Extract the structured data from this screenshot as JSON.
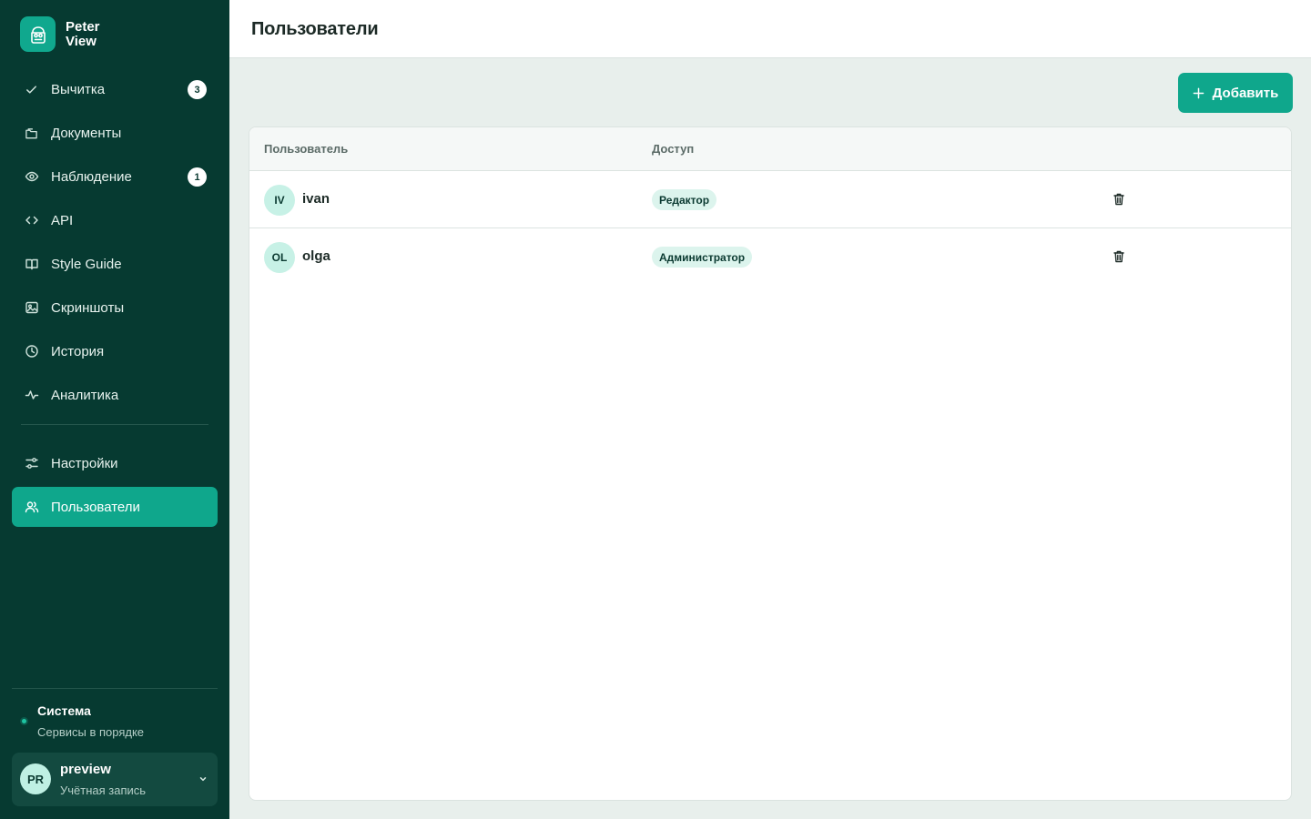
{
  "brand": {
    "name": "Peter View",
    "icon": "peter-logo-icon"
  },
  "sidebar": {
    "nav_primary": [
      {
        "label": "Вычитка",
        "icon": "check-icon",
        "badge": "3"
      },
      {
        "label": "Документы",
        "icon": "folder-icon",
        "badge": null
      },
      {
        "label": "Наблюдение",
        "icon": "eye-icon",
        "badge": "1"
      },
      {
        "label": "API",
        "icon": "code-icon",
        "badge": null
      },
      {
        "label": "Style Guide",
        "icon": "book-icon",
        "badge": null
      },
      {
        "label": "Скриншоты",
        "icon": "image-icon",
        "badge": null
      },
      {
        "label": "История",
        "icon": "clock-icon",
        "badge": null
      },
      {
        "label": "Аналитика",
        "icon": "activity-icon",
        "badge": null
      }
    ],
    "nav_secondary": [
      {
        "label": "Настройки",
        "icon": "sliders-icon",
        "active": false
      },
      {
        "label": "Пользователи",
        "icon": "users-icon",
        "active": true
      }
    ],
    "status": {
      "title": "Система",
      "subtitle": "Сервисы в порядке"
    },
    "account": {
      "initials": "PR",
      "name": "preview",
      "subtitle": "Учётная запись"
    }
  },
  "header": {
    "title": "Пользователи"
  },
  "toolbar": {
    "add_label": "Добавить"
  },
  "table": {
    "columns": [
      "Пользователь",
      "Доступ"
    ],
    "rows": [
      {
        "initials": "IV",
        "name": "ivan",
        "role": "Редактор"
      },
      {
        "initials": "OL",
        "name": "olga",
        "role": "Администратор"
      }
    ]
  },
  "colors": {
    "sidebar_bg": "#063a31",
    "accent": "#0fa78c",
    "page_bg": "#e8efec",
    "badge_role_bg": "#dcf4ed"
  }
}
